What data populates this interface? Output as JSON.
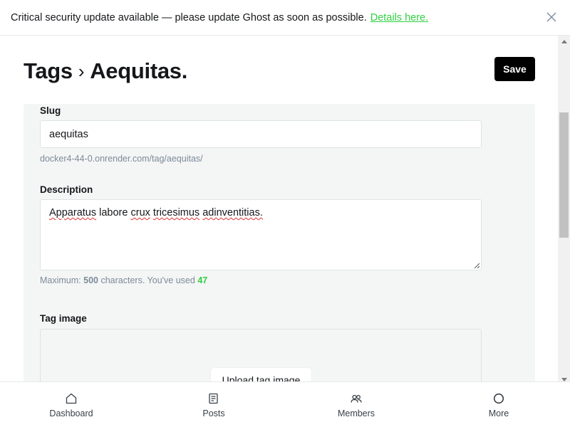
{
  "banner": {
    "message": "Critical security update available — please update Ghost as soon as possible.",
    "link_text": "Details here."
  },
  "header": {
    "breadcrumb_parent": "Tags",
    "breadcrumb_separator": "›",
    "title": "Aequitas.",
    "save_label": "Save"
  },
  "form": {
    "slug": {
      "label": "Slug",
      "value": "aequitas",
      "url_hint": "docker4-44-0.onrender.com/tag/aequitas/"
    },
    "description": {
      "label": "Description",
      "words": [
        "Apparatus",
        "labore",
        "crux",
        "tricesimus",
        "adinventitias."
      ],
      "hint_prefix": "Maximum:",
      "hint_max": "500",
      "hint_middle": "characters. You've used",
      "hint_used": "47"
    },
    "tag_image": {
      "label": "Tag image",
      "upload_label": "Upload tag image"
    }
  },
  "bottom_nav": {
    "items": [
      {
        "label": "Dashboard",
        "icon": "house-icon"
      },
      {
        "label": "Posts",
        "icon": "posts-icon"
      },
      {
        "label": "Members",
        "icon": "members-icon"
      },
      {
        "label": "More",
        "icon": "circle-icon"
      }
    ]
  },
  "colors": {
    "accent_green": "#30cf43",
    "save_button": "#000000",
    "panel_bg": "#f4f5f5"
  }
}
